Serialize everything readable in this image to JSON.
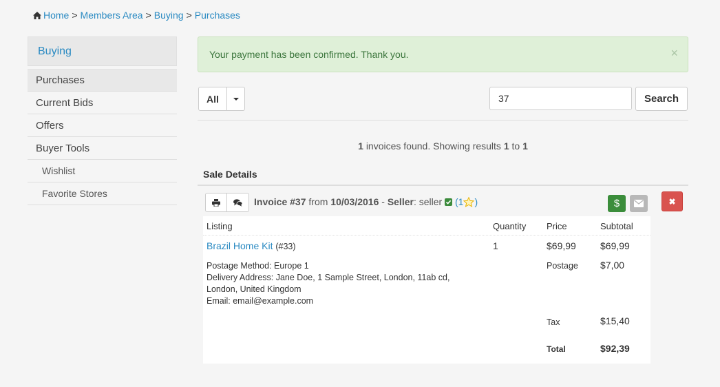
{
  "breadcrumb": {
    "items": [
      "Home",
      "Members Area",
      "Buying",
      "Purchases"
    ],
    "separator": ">"
  },
  "sidebar": {
    "heading": "Buying",
    "items": [
      {
        "label": "Purchases"
      },
      {
        "label": "Current Bids"
      },
      {
        "label": "Offers"
      },
      {
        "label": "Buyer Tools"
      },
      {
        "label": "Wishlist"
      },
      {
        "label": "Favorite Stores"
      }
    ]
  },
  "alert": {
    "message": "Your payment has been confirmed. Thank you.",
    "close": "×"
  },
  "filter": {
    "selected": "All"
  },
  "search": {
    "value": "37",
    "button": "Search"
  },
  "results": {
    "count": "1",
    "text1": "invoices found. Showing results",
    "from": "1",
    "to_word": "to",
    "to": "1"
  },
  "section_title": "Sale Details",
  "invoice": {
    "label": "Invoice #37",
    "from_word": "from",
    "date": "10/03/2016",
    "dash": "-",
    "seller_label": "Seller",
    "seller_name": "seller",
    "rating_open": "(1",
    "rating_close": ")",
    "pay_symbol": "$",
    "delete_symbol": "✖"
  },
  "table": {
    "headers": {
      "listing": "Listing",
      "quantity": "Quantity",
      "price": "Price",
      "subtotal": "Subtotal"
    },
    "item": {
      "name": "Brazil Home Kit",
      "id": "(#33)",
      "quantity": "1",
      "price": "$69,99",
      "subtotal": "$69,99"
    },
    "postage_method": "Postage Method: Europe 1",
    "delivery_address": "Delivery Address: Jane Doe, 1 Sample Street, London, 11ab cd, London, United Kingdom",
    "email": "Email: email@example.com",
    "postage_label": "Postage",
    "postage_value": "$7,00",
    "tax_label": "Tax",
    "tax_value": "$15,40",
    "total_label": "Total",
    "total_value": "$92,39"
  },
  "colors": {
    "link": "#2a8ac2",
    "success_bg": "#dff0d8",
    "danger": "#d9534f",
    "pay": "#3b8d3b"
  }
}
